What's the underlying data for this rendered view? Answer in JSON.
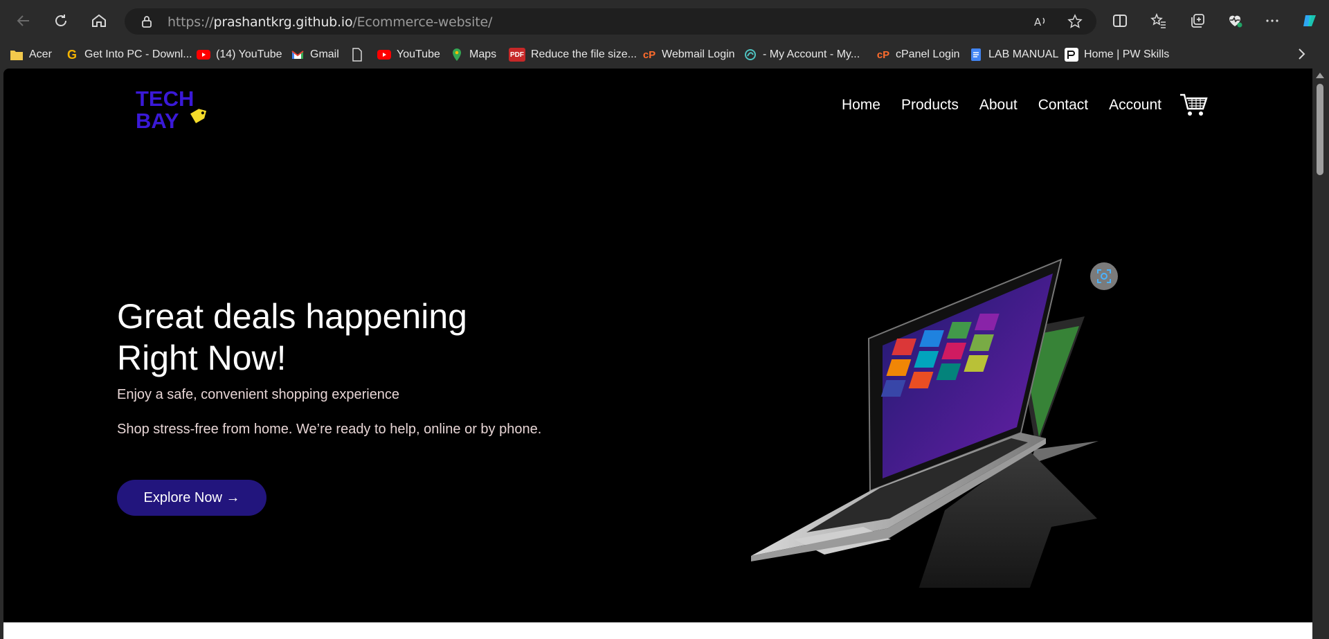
{
  "browser": {
    "url_prefix": "https://",
    "url_host": "prashantkrg.github.io",
    "url_path": "/Ecommerce-website/"
  },
  "bookmarks": [
    {
      "label": "Acer",
      "icon": "folder-icon"
    },
    {
      "label": "Get Into PC - Downl...",
      "icon": "g-icon"
    },
    {
      "label": "(14) YouTube",
      "icon": "youtube-icon"
    },
    {
      "label": "Gmail",
      "icon": "gmail-icon"
    },
    {
      "label": "",
      "icon": "page-icon"
    },
    {
      "label": "YouTube",
      "icon": "youtube-icon"
    },
    {
      "label": "Maps",
      "icon": "maps-icon"
    },
    {
      "label": "Reduce the file size...",
      "icon": "pdf-icon"
    },
    {
      "label": "Webmail Login",
      "icon": "cpanel-icon"
    },
    {
      "label": "- My Account - My...",
      "icon": "account-icon"
    },
    {
      "label": "cPanel Login",
      "icon": "cpanel-icon"
    },
    {
      "label": "LAB MANUAL",
      "icon": "docs-icon"
    },
    {
      "label": "Home | PW Skills",
      "icon": "pwskills-icon"
    }
  ],
  "site": {
    "logo_line1": "TECH",
    "logo_line2": "BAY",
    "nav": {
      "home": "Home",
      "products": "Products",
      "about": "About",
      "contact": "Contact",
      "account": "Account"
    },
    "hero": {
      "title_line1": "Great deals happening",
      "title_line2": "Right Now!",
      "subtitle1": "Enjoy a safe, convenient shopping experience",
      "subtitle2": "Shop stress-free from home. We’re ready to help, online or by phone.",
      "cta": "Explore Now →"
    }
  },
  "colors": {
    "logo": "#3a19d8",
    "tag": "#f5dc2a",
    "cta_bg": "#22157d",
    "page_bg": "#000000"
  }
}
